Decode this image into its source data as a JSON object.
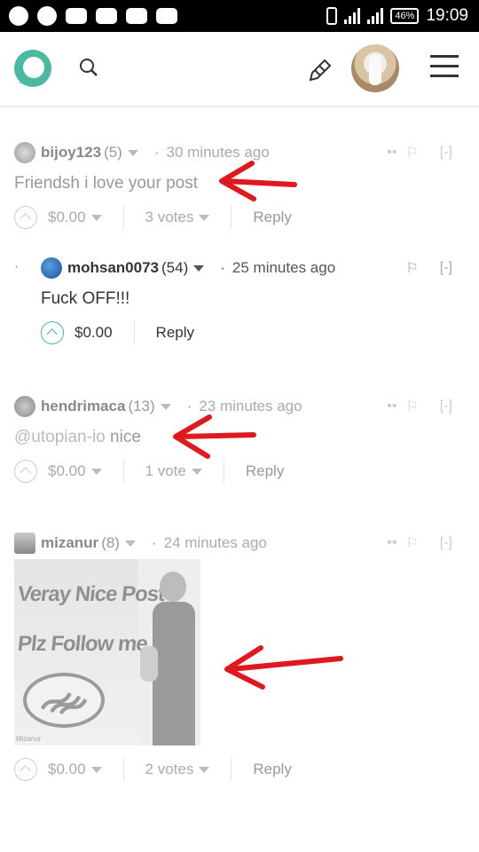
{
  "status_bar": {
    "battery": "46%",
    "time": "19:09"
  },
  "comments": [
    {
      "author": "bijoy123",
      "rep": "(5)",
      "time": "30 minutes ago",
      "body": "Friendsh i love your post",
      "payout": "$0.00",
      "votes": "3 votes",
      "reply": "Reply",
      "collapse": "[-]"
    },
    {
      "author": "mohsan0073",
      "rep": "(54)",
      "time": "25 minutes ago",
      "body": "Fuck OFF!!!",
      "payout": "$0.00",
      "reply": "Reply",
      "collapse": "[-]"
    },
    {
      "author": "hendrimaca",
      "rep": "(13)",
      "time": "23 minutes ago",
      "mention": "@utopian-io",
      "body": " nice",
      "payout": "$0.00",
      "votes": "1 vote",
      "reply": "Reply",
      "collapse": "[-]"
    },
    {
      "author": "mizanur",
      "rep": "(8)",
      "time": "24 minutes ago",
      "image_text": [
        "Veray Nice Post",
        "Plz Follow me"
      ],
      "image_caption": "Mizanur",
      "payout": "$0.00",
      "votes": "2 votes",
      "reply": "Reply",
      "collapse": "[-]"
    }
  ],
  "colors": {
    "brand": "#4ab9a0",
    "arrow": "#e0191e"
  }
}
